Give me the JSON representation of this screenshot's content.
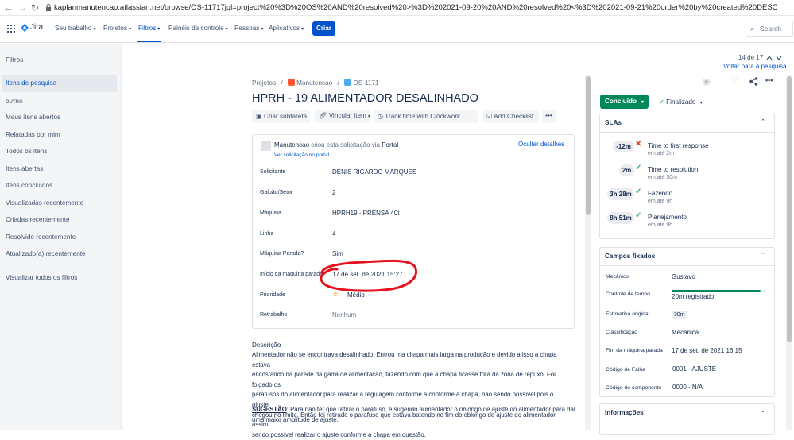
{
  "browser": {
    "url": "kaplanmanutencao.atlassian.net/browse/OS-11717jql=project%20%3D%20OS%20AND%20resolved%20>%3D%202021-09-20%20AND%20resolved%20<%3D%202021-09-21%20order%20by%20created%20DESC"
  },
  "nav": {
    "logo": "Jira",
    "items": [
      "Seu trabalho",
      "Projetos",
      "Filtros",
      "Painéis de controle",
      "Pessoas",
      "Aplicativos"
    ],
    "create": "Criar",
    "search_placeholder": "Search"
  },
  "sidebar": {
    "title": "Filtros",
    "selected": "Itens de pesquisa",
    "section": "OUTRO",
    "items": [
      "Meus itens abertos",
      "Relatadas por mim",
      "Todos os itens",
      "Itens abertas",
      "Itens concluídos",
      "Visualizadas recentemente",
      "Criadas recentemente",
      "Resolvido recentemente",
      "Atualizado(a) recentemente"
    ],
    "view_all": "Visualizar todos os filtros"
  },
  "pager": {
    "position": "14 de 17",
    "back_link": "Voltar para a pesquisa"
  },
  "breadcrumb": {
    "root": "Projetos",
    "project": "Manutencao",
    "issue": "OS-1171"
  },
  "issue": {
    "title": "HPRH - 19 ALIMENTADOR DESALINHADO",
    "actions": [
      "Criar subtarefa",
      "Vincular item",
      "Track time with Clockwork",
      "Add Checklist"
    ],
    "more": "•••"
  },
  "request": {
    "creator": "Manutencao",
    "created_text": "criou esta solicitação via",
    "channel": "Portal",
    "portal_link": "Ver solicitação no portal",
    "hide_details": "Ocultar detalhes",
    "fields": [
      {
        "label": "Solicitante",
        "value": "DENIS RICARDO MARQUES"
      },
      {
        "label": "Galpão/Setor",
        "value": "2"
      },
      {
        "label": "Máquina",
        "value": "HPRH19 - PRENSA 40t"
      },
      {
        "label": "Linha",
        "value": "4"
      },
      {
        "label": "Máquina Parada?",
        "value": "Sim"
      },
      {
        "label": "Início da máquina parada.",
        "value": "17 de set. de 2021 15:27"
      },
      {
        "label": "Prioridade",
        "value": "Médio"
      },
      {
        "label": "Retrabalho",
        "value": "Nenhum"
      }
    ]
  },
  "description": {
    "heading": "Descrição",
    "lines": [
      "Alimentador não se encontrava desalinhado. Entrou ma chapa mais larga na produção e devido a isso a chapa estava",
      "encostando na parede da garra de alimentação, fazendo com que a chapa ficasse fora da zona de repuxo. Foi folgado os",
      "parafusos do alimentador para realizar a regulagem conforme a conforme a chapa, não sendo possível pois o ajuste",
      "chegou no limite. Então foi retirado o parafuso que estava batendo no fim do oblongo de ajuste do alimentador, assim",
      "sendo possível realizar o ajuste conforme a chapa em questão."
    ],
    "suggestion_label": "SUGESTÃO",
    "suggestion_text": ": Para não ter que retirar o parafuso, é sugerido aumentador o oblongo de ajuste do alimentador para dar",
    "suggestion_line2": "uma maior amplitude de ajuste."
  },
  "status": {
    "button": "Concluído",
    "resolution": "Finalizado"
  },
  "slas": {
    "title": "SLAs",
    "items": [
      {
        "time": "-12m",
        "name": "Time to first response",
        "sub": "em até 2m",
        "breached": true
      },
      {
        "time": "2m",
        "name": "Time to resolution",
        "sub": "em até 30m",
        "breached": false
      },
      {
        "time": "3h 28m",
        "name": "Fazendo",
        "sub": "em até 9h",
        "breached": false
      },
      {
        "time": "8h 51m",
        "name": "Planejamento",
        "sub": "em até 9h",
        "breached": false
      }
    ]
  },
  "fixed_fields": {
    "title": "Campos fixados",
    "mechanic_label": "Mecânico",
    "mechanic": "Gustavo",
    "time_control_label": "Controle de tempo",
    "time_logged": "20m registrado",
    "time_logged_fraction": 0.95,
    "estimate_label": "Estimativa original",
    "estimate": "30m",
    "class_label": "Classificação",
    "class": "Mecânica",
    "end_label": "Fim da máquina parada",
    "end": "17 de set. de 2021 16:15",
    "fault_label": "Código de Falha",
    "fault": "0001 - AJUSTE",
    "component_label": "Código de componente",
    "component": "0000 - N/A"
  },
  "info": {
    "title": "Informações"
  },
  "colors": {
    "primary": "#0052cc",
    "done": "#00875a",
    "annotation": "#e5121b"
  }
}
